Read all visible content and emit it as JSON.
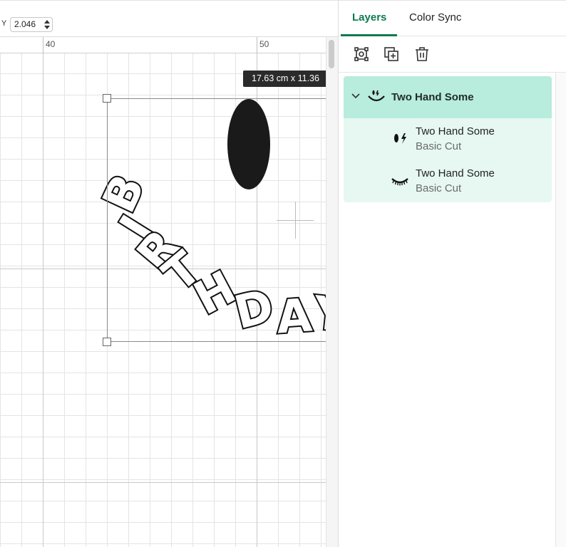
{
  "toolbar_top": {
    "y_label": "Y",
    "y_value": "2.046"
  },
  "ruler": {
    "labels": [
      "40",
      "50"
    ]
  },
  "canvas": {
    "dimension_tooltip": "17.63  cm x 11.36",
    "letters": [
      "B",
      "I",
      "R",
      "T",
      "H",
      "D",
      "A",
      "Y"
    ]
  },
  "panel": {
    "tabs": [
      {
        "label": "Layers",
        "active": true
      },
      {
        "label": "Color Sync",
        "active": false
      }
    ],
    "tools": [
      "group-icon",
      "duplicate-icon",
      "trash-icon"
    ],
    "group": {
      "title": "Two Hand Some",
      "expanded": true,
      "children": [
        {
          "title": "Two Hand Some",
          "subtitle": "Basic Cut",
          "icon": "eyes-icon"
        },
        {
          "title": "Two Hand Some",
          "subtitle": "Basic Cut",
          "icon": "smile-icon"
        }
      ]
    }
  },
  "colors": {
    "accent": "#0d7a50",
    "group_bg": "#b8ecdc",
    "children_bg": "#e6f8f1"
  }
}
